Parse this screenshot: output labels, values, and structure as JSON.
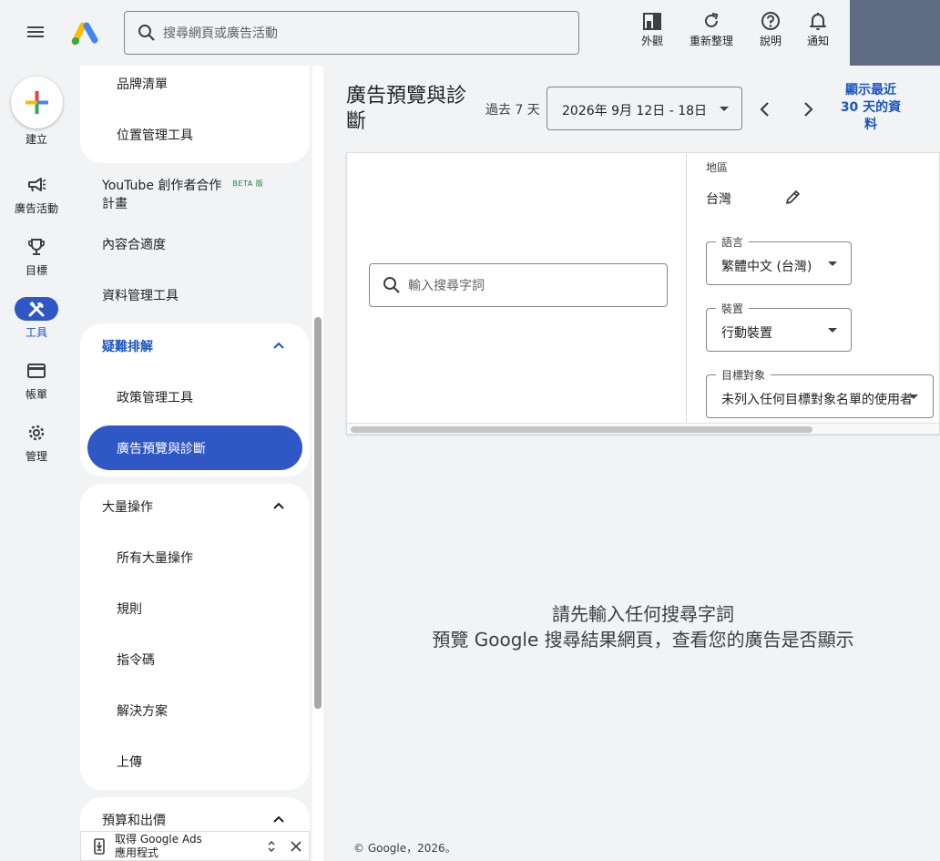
{
  "header": {
    "search_placeholder": "搜尋網頁或廣告活動",
    "actions": [
      {
        "label": "外觀",
        "icon": "appearance-icon"
      },
      {
        "label": "重新整理",
        "icon": "refresh-icon"
      },
      {
        "label": "說明",
        "icon": "help-icon"
      },
      {
        "label": "通知",
        "icon": "bell-icon"
      }
    ]
  },
  "rail": {
    "create_label": "建立",
    "items": [
      {
        "label": "廣告活動",
        "icon": "megaphone-icon"
      },
      {
        "label": "目標",
        "icon": "trophy-icon"
      },
      {
        "label": "工具",
        "icon": "tools-icon",
        "active": true
      },
      {
        "label": "帳單",
        "icon": "credit-card-icon"
      },
      {
        "label": "管理",
        "icon": "gear-icon"
      }
    ]
  },
  "nav": {
    "brand_list": "品牌清單",
    "location_manager": "位置管理工具",
    "youtube_creator_line1": "YouTube 創作者合作",
    "youtube_creator_line2": "計畫",
    "beta": "BETA 版",
    "content_suitability": "內容合適度",
    "data_manager": "資料管理工具",
    "troubleshooting": "疑難排解",
    "policy_manager": "政策管理工具",
    "ad_preview": "廣告預覽與診斷",
    "bulk_actions": "大量操作",
    "all_bulk_actions": "所有大量操作",
    "rules": "規則",
    "scripts": "指令碼",
    "solutions": "解決方案",
    "uploads": "上傳",
    "budgets_bidding": "預算和出價",
    "app_promo_line1": "取得 Google Ads",
    "app_promo_line2": "應用程式"
  },
  "main": {
    "title": "廣告預覽與診斷",
    "range_label": "過去 7 天",
    "date_range": "2026年 9月 12日 - 18日",
    "show_30": "顯示最近 30 天的資料",
    "keyword_placeholder": "輸入搜尋字詞",
    "location_label": "地區",
    "location_value": "台灣",
    "language_label": "語言",
    "language_value": "繁體中文 (台灣)",
    "device_label": "裝置",
    "device_value": "行動裝置",
    "audience_label": "目標對象",
    "audience_value": "未列入任何目標對象名單的使用者",
    "empty_line1": "請先輸入任何搜尋字詞",
    "empty_line2": "預覽 Google 搜尋結果網頁，查看您的廣告是否顯示",
    "footer": "© Google，2026。"
  },
  "colors": {
    "accent": "#1a56c8",
    "active_pill": "#2f57c6",
    "avatar_block": "#606c84",
    "background": "#f1f3f4"
  }
}
